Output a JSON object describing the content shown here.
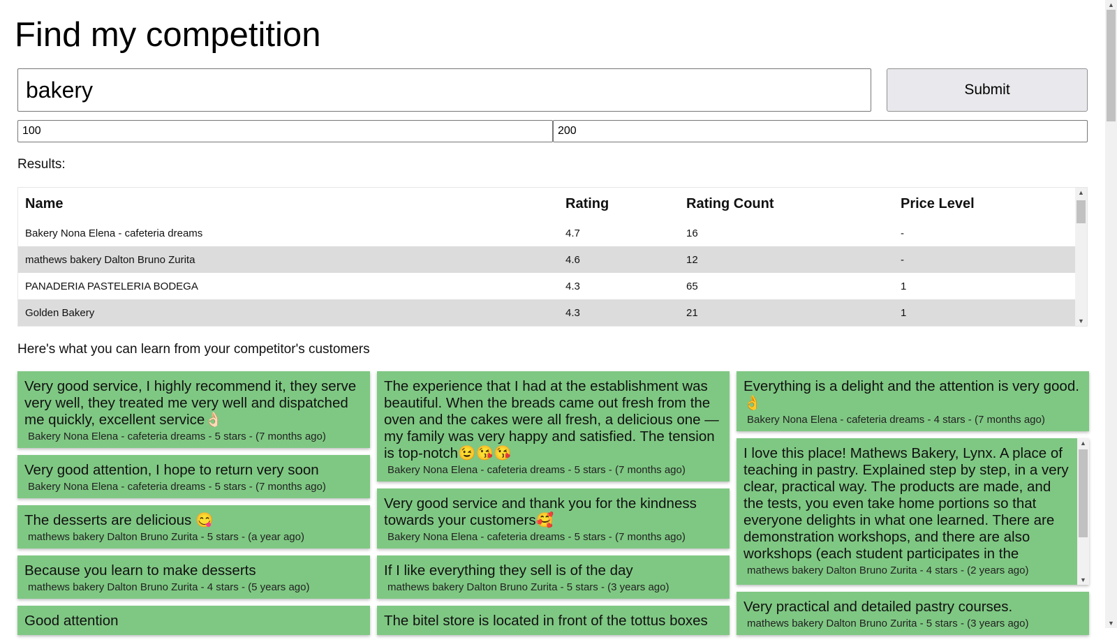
{
  "page": {
    "title": "Find my competition"
  },
  "search": {
    "value": "bakery",
    "submit_label": "Submit"
  },
  "range": {
    "min": "100",
    "max": "200"
  },
  "results": {
    "label": "Results:",
    "columns": [
      "Name",
      "Rating",
      "Rating Count",
      "Price Level"
    ],
    "rows": [
      [
        "Bakery Nona Elena - cafeteria dreams",
        "4.7",
        "16",
        "-"
      ],
      [
        "mathews bakery Dalton Bruno Zurita",
        "4.6",
        "12",
        "-"
      ],
      [
        "PANADERIA PASTELERIA BODEGA",
        "4.3",
        "65",
        "1"
      ],
      [
        "Golden Bakery",
        "4.3",
        "21",
        "1"
      ]
    ]
  },
  "learn": {
    "heading": "Here's what you can learn from your competitor's customers",
    "columns": [
      [
        {
          "text": "Very good service, I highly recommend it, they serve very well, they treated me very well and dispatched me quickly, excellent service👌🏻",
          "meta": "Bakery Nona Elena - cafeteria dreams - 5 stars - (7 months ago)"
        },
        {
          "text": "Very good attention, I hope to return very soon",
          "meta": "Bakery Nona Elena - cafeteria dreams - 5 stars - (7 months ago)"
        },
        {
          "text": "The desserts are delicious 😋",
          "meta": "mathews bakery Dalton Bruno Zurita - 5 stars - (a year ago)"
        },
        {
          "text": "Because you learn to make desserts",
          "meta": "mathews bakery Dalton Bruno Zurita - 4 stars - (5 years ago)"
        },
        {
          "text": "Good attention",
          "meta": ""
        }
      ],
      [
        {
          "text": "The experience that I had at the establishment was beautiful. When the breads came out fresh from the oven and the cakes were all fresh, a delicious one — my family was very happy and satisfied. The tension is top-notch😉😘😘",
          "meta": "Bakery Nona Elena - cafeteria dreams - 5 stars - (7 months ago)"
        },
        {
          "text": "Very good service and thank you for the kindness towards your customers🥰",
          "meta": "Bakery Nona Elena - cafeteria dreams - 5 stars - (7 months ago)"
        },
        {
          "text": "If I like everything they sell is of the day",
          "meta": "mathews bakery Dalton Bruno Zurita - 5 stars - (3 years ago)"
        },
        {
          "text": "The bitel store is located in front of the tottus boxes",
          "meta": ""
        }
      ],
      [
        {
          "text": "Everything is a delight and the attention is very good.👌",
          "meta": "Bakery Nona Elena - cafeteria dreams - 4 stars - (7 months ago)"
        },
        {
          "text": "I love this place! Mathews Bakery, Lynx. A place of teaching in pastry. Explained step by step, in a very clear, practical way. The products are made, and the tests, you even take home portions so that everyone delights in what one learned. There are demonstration workshops, and there are also workshops (each student participates in the",
          "meta": "mathews bakery Dalton Bruno Zurita - 4 stars - (2 years ago)"
        },
        {
          "text": "Very practical and detailed pastry courses.",
          "meta": "mathews bakery Dalton Bruno Zurita - 5 stars - (3 years ago)"
        }
      ]
    ]
  }
}
